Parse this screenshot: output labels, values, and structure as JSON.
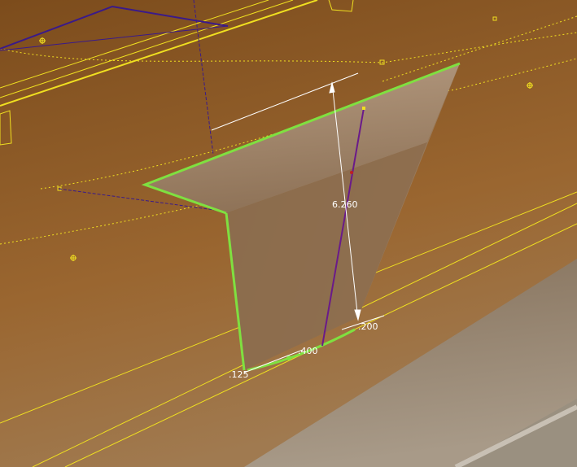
{
  "viewport": {
    "type": "cad-3d-view",
    "background_top": "#845121",
    "background_bottom": "#b0a08a",
    "floor_color": "#8f8170"
  },
  "part": {
    "face_color": "#9b7f63",
    "top_face_color": "#a88a6e",
    "edge_highlight": "#7fe040"
  },
  "dimensions": {
    "height": "6.260",
    "bottom_right": ".200",
    "bottom_mid": ".400",
    "bottom_left": ".125"
  },
  "colors": {
    "sketch_yellow": "#f0e020",
    "construction_purple": "#3a1a8a",
    "dimension_white": "#ffffff",
    "selection_green": "#7fe040"
  }
}
